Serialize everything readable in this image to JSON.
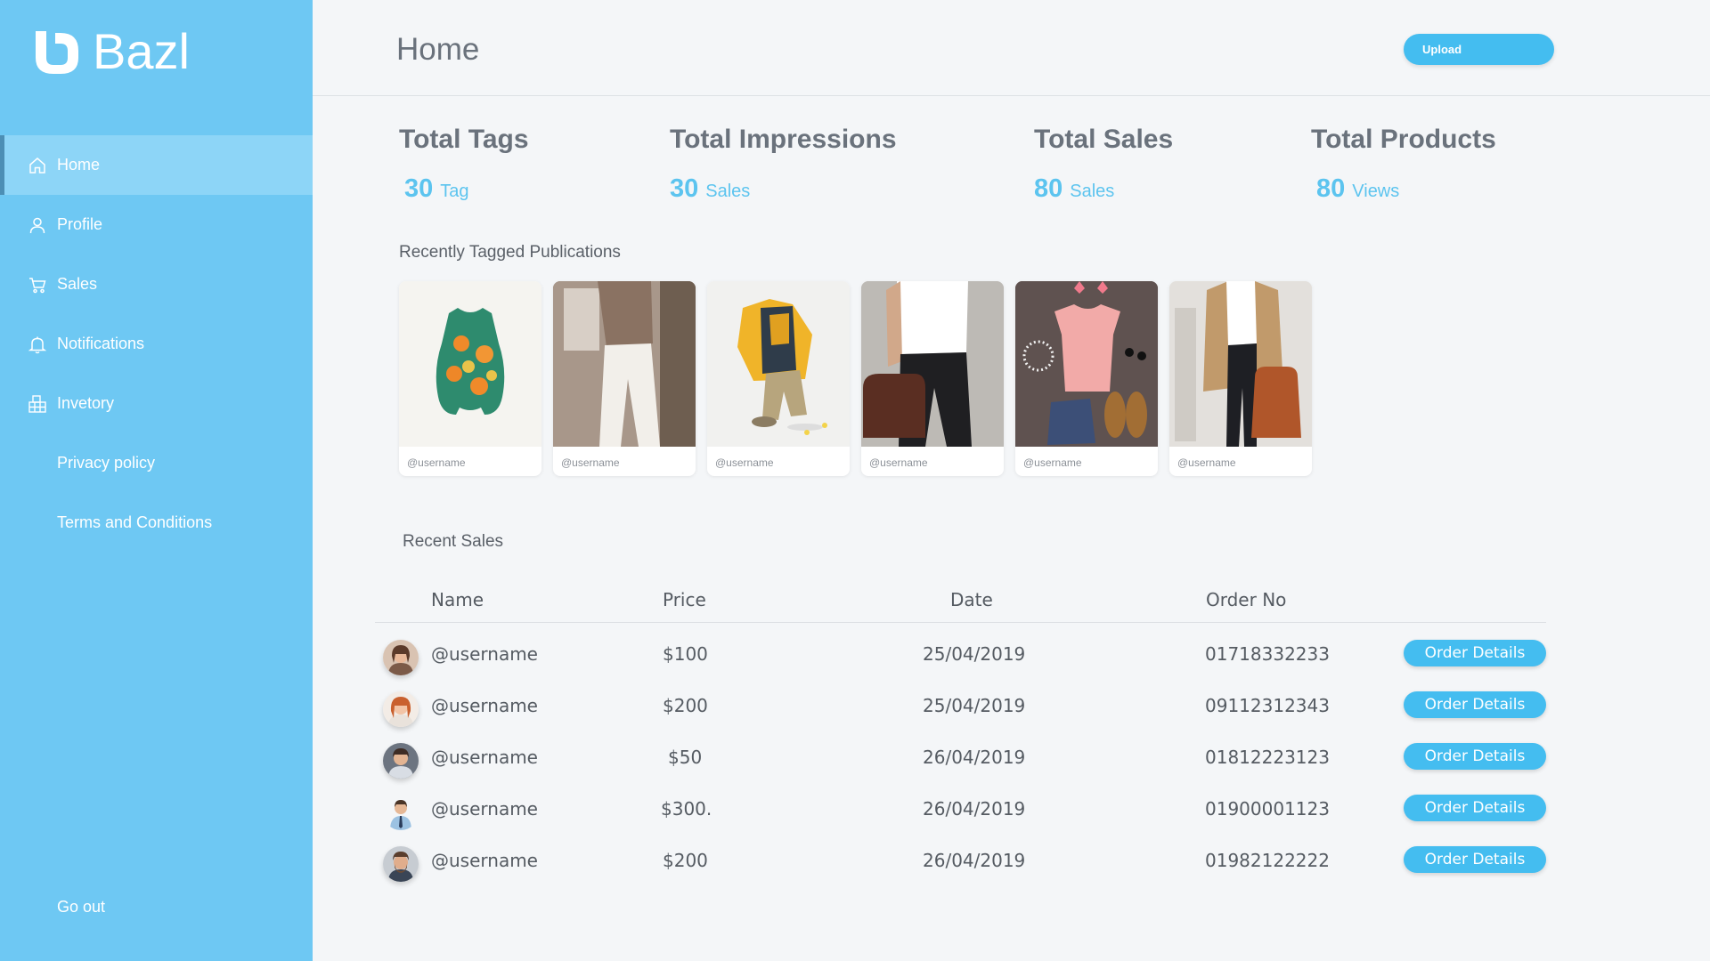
{
  "app": {
    "name": "Bazl"
  },
  "sidebar": {
    "items": [
      {
        "label": "Home",
        "icon": "home-icon",
        "active": true
      },
      {
        "label": "Profile",
        "icon": "user-icon",
        "active": false
      },
      {
        "label": "Sales",
        "icon": "cart-icon",
        "active": false
      },
      {
        "label": "Notifications",
        "icon": "bell-icon",
        "active": false
      },
      {
        "label": "Invetory",
        "icon": "inventory-icon",
        "active": false
      },
      {
        "label": "Privacy policy",
        "icon": "",
        "active": false
      },
      {
        "label": "Terms and Conditions",
        "icon": "",
        "active": false
      }
    ],
    "go_out": "Go out"
  },
  "header": {
    "title": "Home",
    "upload_label": "Upload"
  },
  "stats": [
    {
      "title": "Total Tags",
      "value": "30",
      "unit": "Tag"
    },
    {
      "title": "Total Impressions",
      "value": "30",
      "unit": "Sales"
    },
    {
      "title": "Total Sales",
      "value": "80",
      "unit": "Sales"
    },
    {
      "title": "Total Products",
      "value": "80",
      "unit": "Views"
    }
  ],
  "publications": {
    "title": "Recently Tagged Publications",
    "items": [
      {
        "user": "@username",
        "image": "green-floral-romper"
      },
      {
        "user": "@username",
        "image": "white-jeans-outfit"
      },
      {
        "user": "@username",
        "image": "kids-outfit-flatlay"
      },
      {
        "user": "@username",
        "image": "man-with-duffel-bag"
      },
      {
        "user": "@username",
        "image": "pink-top-flatlay"
      },
      {
        "user": "@username",
        "image": "woman-with-handbag"
      }
    ]
  },
  "sales": {
    "title": "Recent Sales",
    "columns": {
      "name": "Name",
      "price": "Price",
      "date": "Date",
      "order_no": "Order No"
    },
    "button_label": "Order Details",
    "rows": [
      {
        "name": "@username",
        "price": "$100",
        "date": "25/04/2019",
        "order_no": "01718332233"
      },
      {
        "name": "@username",
        "price": "$200",
        "date": "25/04/2019",
        "order_no": "09112312343"
      },
      {
        "name": "@username",
        "price": "$50",
        "date": "26/04/2019",
        "order_no": "01812223123"
      },
      {
        "name": "@username",
        "price": "$300.",
        "date": "26/04/2019",
        "order_no": "01900001123"
      },
      {
        "name": "@username",
        "price": "$200",
        "date": "26/04/2019",
        "order_no": "01982122222"
      }
    ]
  },
  "colors": {
    "sidebar": "#6ec8f3",
    "accent": "#44bdf0",
    "stat_value": "#5cc4ef",
    "background": "#f4f6f8"
  }
}
